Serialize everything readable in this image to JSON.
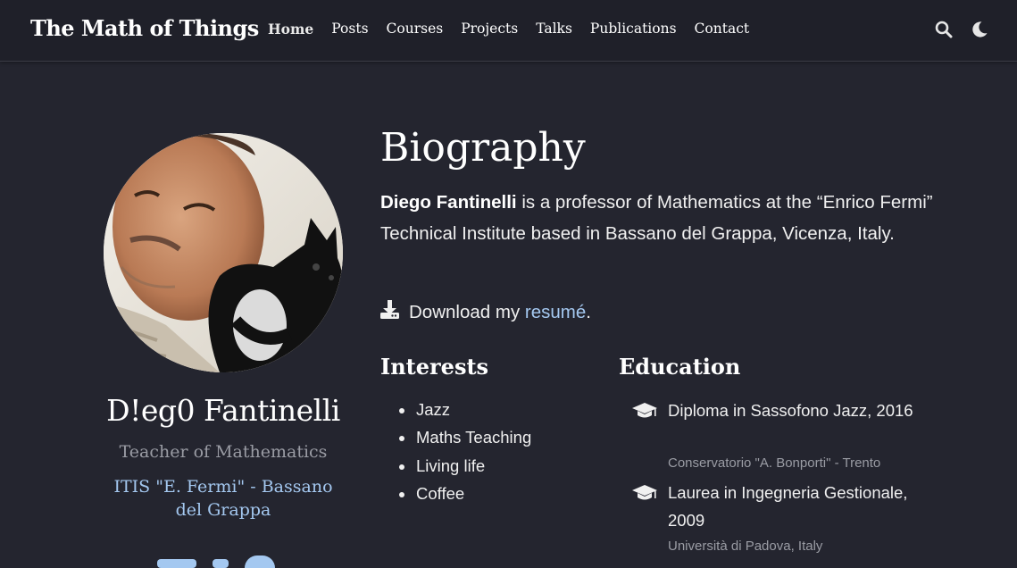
{
  "navbar": {
    "brand": "The Math of Things",
    "links": [
      "Home",
      "Posts",
      "Courses",
      "Projects",
      "Talks",
      "Publications",
      "Contact"
    ],
    "active": "Home",
    "icons": [
      "search-icon",
      "moon-icon"
    ]
  },
  "profile": {
    "name": "D!eg0 Fantinelli",
    "role": "Teacher of Mathematics",
    "organization": "ITIS \"E. Fermi\" - Bassano del Grappa",
    "avatar_alt": "Avatar photo of a man with a small black and white dog"
  },
  "biography": {
    "title": "Biography",
    "name_bold": "Diego Fantinelli",
    "text": " is a professor of Mathematics at the “Enrico Fermi” Technical Institute based in Bassano del Grappa, Vicenza, Italy.",
    "download_prefix": "Download my ",
    "download_link": "resumé",
    "download_suffix": "."
  },
  "interests": {
    "title": "Interests",
    "items": [
      "Jazz",
      "Maths Teaching",
      "Living life",
      "Coffee"
    ]
  },
  "education": {
    "title": "Education",
    "items": [
      {
        "degree": "Diploma in Sassofono Jazz, 2016",
        "institution": "Conservatorio \"A. Bonporti\" - Trento"
      },
      {
        "degree": "Laurea in Ingegneria Gestionale, 2009",
        "institution": "Università di Padova, Italy"
      }
    ]
  },
  "colors": {
    "background": "#24252f",
    "navbar": "#1f2029",
    "link": "#a4c8f0",
    "muted": "#9a9ca4"
  }
}
